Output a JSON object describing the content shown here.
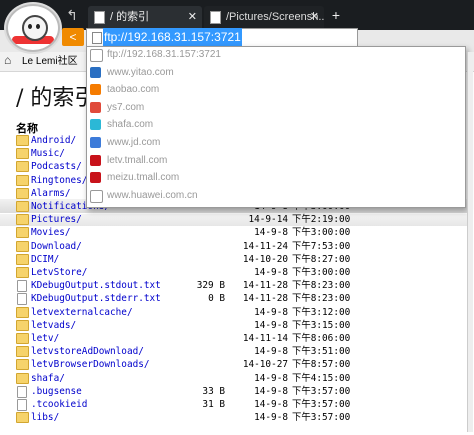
{
  "browser": {
    "tabs": [
      {
        "title": "/ 的索引",
        "active": true
      },
      {
        "title": "/Pictures/Screensh...",
        "active": false
      }
    ],
    "address": {
      "value": "ftp://192.168.31.157:3721"
    },
    "bookmarks": [
      {
        "label": "Le Lemi社区"
      }
    ]
  },
  "suggestions": [
    {
      "text": "ftp://192.168.31.157:3721",
      "icon": "file-icon",
      "color": "#ffffff"
    },
    {
      "text": "www.yitao.com",
      "icon": "yitao-icon",
      "color": "#2a6fc2"
    },
    {
      "text": "taobao.com",
      "icon": "taobao-icon",
      "color": "#f57b00"
    },
    {
      "text": "ys7.com",
      "icon": "ys7-icon",
      "color": "#e04a3a"
    },
    {
      "text": "shafa.com",
      "icon": "shafa-icon",
      "color": "#2bb8d6"
    },
    {
      "text": "www.jd.com",
      "icon": "jd-icon",
      "color": "#3d7bd9"
    },
    {
      "text": "letv.tmall.com",
      "icon": "tmall-icon",
      "color": "#c8121a"
    },
    {
      "text": "meizu.tmall.com",
      "icon": "tmall-icon",
      "color": "#c8121a"
    },
    {
      "text": "www.huawei.com.cn",
      "icon": "file-icon",
      "color": "#ffffff"
    }
  ],
  "page": {
    "title": "/ 的索引",
    "column_name": "名称",
    "files": [
      {
        "name": "Android/",
        "size": "",
        "date": "",
        "time": "",
        "type": "folder"
      },
      {
        "name": "Music/",
        "size": "",
        "date": "",
        "time": "",
        "type": "folder"
      },
      {
        "name": "Podcasts/",
        "size": "",
        "date": "",
        "time": "",
        "type": "folder"
      },
      {
        "name": "Ringtones/",
        "size": "",
        "date": "",
        "time": "",
        "type": "folder"
      },
      {
        "name": "Alarms/",
        "size": "",
        "date": "",
        "time": "",
        "type": "folder"
      },
      {
        "name": "Notifications/",
        "size": "",
        "date": "14-9-8",
        "time": "下午3:00:00",
        "type": "folder"
      },
      {
        "name": "Pictures/",
        "size": "",
        "date": "14-9-14",
        "time": "下午2:19:00",
        "type": "folder"
      },
      {
        "name": "Movies/",
        "size": "",
        "date": "14-9-8",
        "time": "下午3:00:00",
        "type": "folder"
      },
      {
        "name": "Download/",
        "size": "",
        "date": "14-11-24",
        "time": "下午7:53:00",
        "type": "folder"
      },
      {
        "name": "DCIM/",
        "size": "",
        "date": "14-10-20",
        "time": "下午8:27:00",
        "type": "folder"
      },
      {
        "name": "LetvStore/",
        "size": "",
        "date": "14-9-8",
        "time": "下午3:00:00",
        "type": "folder"
      },
      {
        "name": "KDebugOutput.stdout.txt",
        "size": "329 B",
        "date": "14-11-28",
        "time": "下午8:23:00",
        "type": "file"
      },
      {
        "name": "KDebugOutput.stderr.txt",
        "size": "0 B",
        "date": "14-11-28",
        "time": "下午8:23:00",
        "type": "file"
      },
      {
        "name": "letvexternalcache/",
        "size": "",
        "date": "14-9-8",
        "time": "下午3:12:00",
        "type": "folder"
      },
      {
        "name": "letvads/",
        "size": "",
        "date": "14-9-8",
        "time": "下午3:15:00",
        "type": "folder"
      },
      {
        "name": "letv/",
        "size": "",
        "date": "14-11-14",
        "time": "下午8:06:00",
        "type": "folder"
      },
      {
        "name": "letvstoreAdDownload/",
        "size": "",
        "date": "14-9-8",
        "time": "下午3:51:00",
        "type": "folder"
      },
      {
        "name": "letvBrowserDownloads/",
        "size": "",
        "date": "14-10-27",
        "time": "下午8:57:00",
        "type": "folder"
      },
      {
        "name": "shafa/",
        "size": "",
        "date": "14-9-8",
        "time": "下午4:15:00",
        "type": "folder"
      },
      {
        "name": ".bugsense",
        "size": "33 B",
        "date": "14-9-8",
        "time": "下午3:57:00",
        "type": "file"
      },
      {
        "name": ".tcookieid",
        "size": "31 B",
        "date": "14-9-8",
        "time": "下午3:57:00",
        "type": "file"
      },
      {
        "name": "libs/",
        "size": "",
        "date": "14-9-8",
        "time": "下午3:57:00",
        "type": "folder"
      }
    ]
  }
}
